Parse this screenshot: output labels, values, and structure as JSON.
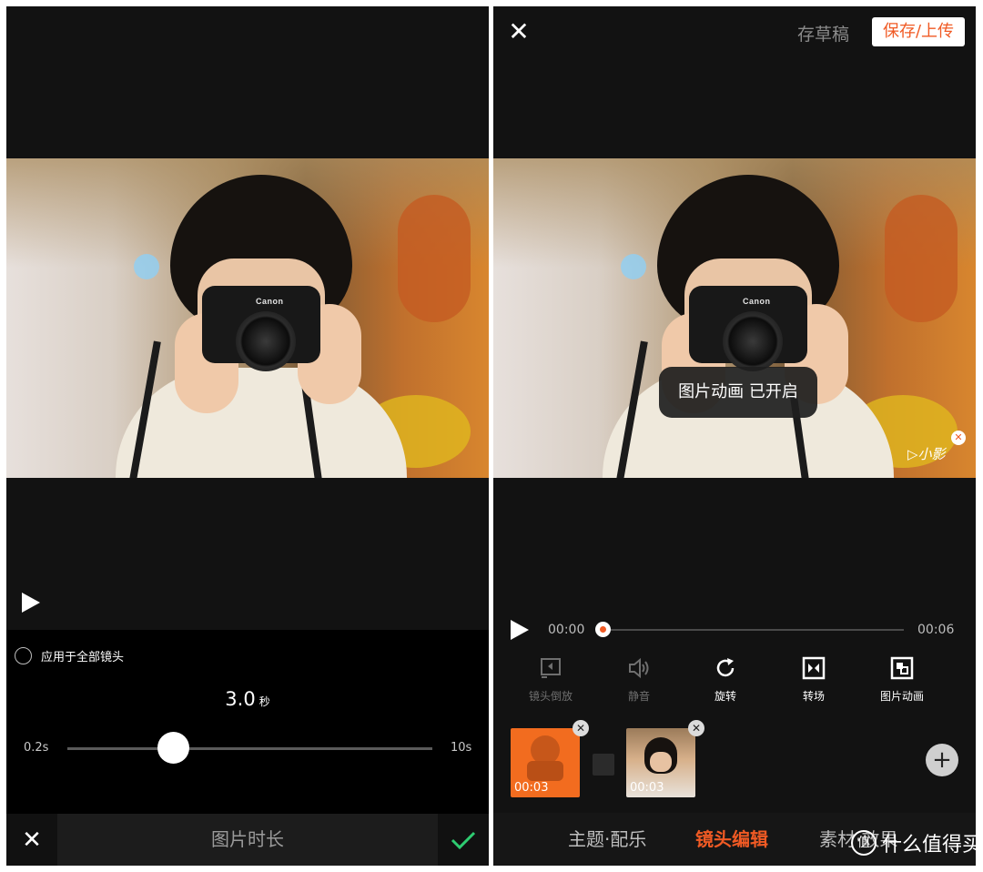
{
  "left": {
    "apply_all_label": "应用于全部镜头",
    "duration_value": "3.0",
    "duration_unit": "秒",
    "slider": {
      "min_label": "0.2s",
      "max_label": "10s",
      "value_fraction": 0.29
    },
    "bottom_title": "图片时长",
    "close_glyph": "✕"
  },
  "photo": {
    "camera_brand": "Canon"
  },
  "right": {
    "close_glyph": "✕",
    "draft_label": "存草稿",
    "save_label": "保存/上传",
    "toast": "图片动画 已开启",
    "watermark": "▷小影",
    "watermark_close": "✕",
    "time_start": "00:00",
    "time_end": "00:06",
    "progress_fraction": 0.0,
    "tools": [
      {
        "label": "镜头倒放",
        "icon": "reverse-icon",
        "enabled": false
      },
      {
        "label": "静音",
        "icon": "volume-icon",
        "enabled": false
      },
      {
        "label": "旋转",
        "icon": "rotate-icon",
        "enabled": true
      },
      {
        "label": "转场",
        "icon": "transition-icon",
        "enabled": true
      },
      {
        "label": "图片动画",
        "icon": "image-animation-icon",
        "enabled": true
      }
    ],
    "clips": [
      {
        "time": "00:03",
        "selected": true
      },
      {
        "time": "00:03",
        "selected": false
      }
    ],
    "add_glyph": "+",
    "tabs": [
      {
        "label": "主题·配乐",
        "active": false
      },
      {
        "label": "镜头编辑",
        "active": true
      },
      {
        "label": "素材·效果",
        "active": false
      }
    ]
  },
  "site_mark": {
    "text": "什么值得买",
    "logo": "值"
  },
  "colors": {
    "accent": "#f05a24",
    "confirm": "#2ecc71",
    "bg": "#121212"
  }
}
